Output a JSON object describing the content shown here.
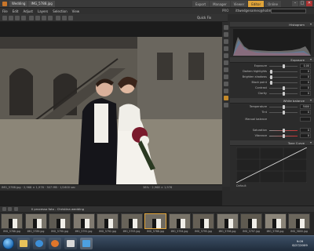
{
  "titlebar": {
    "doc_tab_1": "Wedding",
    "doc_tab_2": "IMG_5788.jpg",
    "mode_tabs": [
      "Export",
      "Manager",
      "Viewer",
      "Editor",
      "Online"
    ],
    "active_mode": "Editor",
    "controls": [
      "–",
      "□",
      "✕"
    ]
  },
  "menu": {
    "items": [
      "File",
      "Edit",
      "Adjust",
      "Layers",
      "Selection",
      "View"
    ],
    "pro_badge": "PRO",
    "account": "ittwedgenames@hotmail.com"
  },
  "toolbar": {
    "quick_fix": "Quick Fix"
  },
  "canvas_status": {
    "info": "IMG_5788.jpg · 2,968 × 1,976 · 307 MB · 1/1600 sec",
    "zoom": "38% · 2,968 × 1,976"
  },
  "panel": {
    "histogram_header": "Histogram",
    "exposure_header": "Exposure",
    "exposure_sliders": [
      {
        "label": "Exposure",
        "value": "0.00",
        "pos": 0.5
      },
      {
        "label": "Darken highlights",
        "value": "0",
        "pos": 0.05
      },
      {
        "label": "Brighten shadows",
        "value": "0",
        "pos": 0.05
      },
      {
        "label": "Black point",
        "value": "0",
        "pos": 0.05
      },
      {
        "label": "Contrast",
        "value": "0",
        "pos": 0.5
      },
      {
        "label": "Clarity",
        "value": "0",
        "pos": 0.5
      }
    ],
    "white_balance_header": "White balance",
    "wb_sliders": [
      {
        "label": "Temperature",
        "value": "5000",
        "pos": 0.5
      },
      {
        "label": "Tint",
        "value": "0",
        "pos": 0.5
      }
    ],
    "wb_mode": "Manual balance",
    "saturation_label": "Saturation",
    "saturation_value": "0",
    "vibrance_label": "Vibrance",
    "vibrance_value": "0",
    "curves_header": "Tone Curve",
    "default_label": "Default"
  },
  "filmstrip": {
    "title": "Il processo foto - Christina wedding",
    "thumbs": [
      {
        "label": "IMG_5788.jpg"
      },
      {
        "label": "IMG_5789.jpg"
      },
      {
        "label": "IMG_5790.jpg"
      },
      {
        "label": "IMG_5791.jpg"
      },
      {
        "label": "IMG_5792.jpg"
      },
      {
        "label": "IMG_5793.jpg"
      },
      {
        "label": "IMG_5788.jpg"
      },
      {
        "label": "IMG_5794.jpg"
      },
      {
        "label": "IMG_5795.jpg"
      },
      {
        "label": "IMG_5796.jpg"
      },
      {
        "label": "IMG_5797.jpg"
      },
      {
        "label": "IMG_5798.jpg"
      },
      {
        "label": "IMG_5800.jpg"
      }
    ],
    "active_index": 6
  },
  "taskbar": {
    "clock_time": "9:09",
    "clock_date": "8/27/2009",
    "apps": [
      "explorer",
      "ie",
      "firefox",
      "media",
      "acdsee"
    ]
  },
  "colors": {
    "accent": "#e0a43a",
    "panel_bg": "#2b2b2b"
  }
}
